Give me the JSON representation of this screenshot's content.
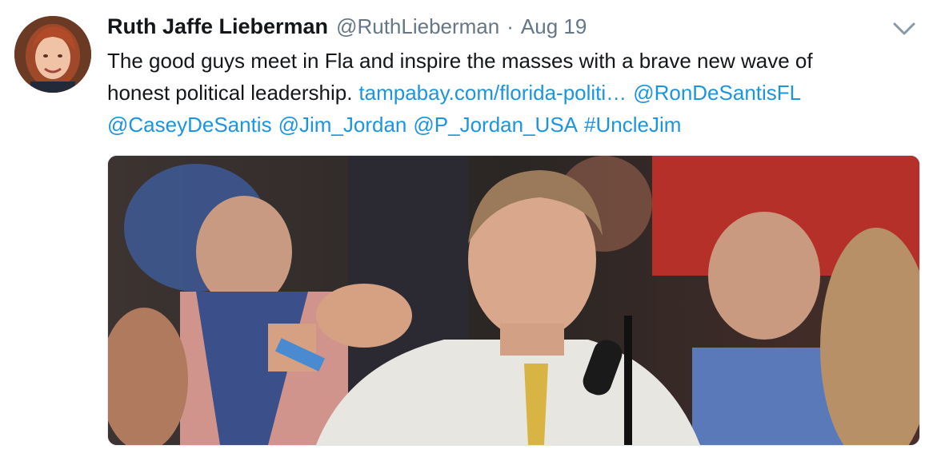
{
  "tweet": {
    "author_name": "Ruth Jaffe Lieberman",
    "author_handle": "@RuthLieberman",
    "separator": "·",
    "date": "Aug 19",
    "text_line1": "The good guys meet in Fla and inspire the masses with a brave new wave of",
    "text_line2_plain": "honest political leadership.",
    "link_url_text": "tampabay.com/florida-politi…",
    "mention_1": "@RonDeSantisFL",
    "mention_2": "@CaseyDeSantis",
    "mention_3": "@Jim_Jordan",
    "mention_4": "@P_Jordan_USA",
    "hashtag": "#UncleJim"
  },
  "icons": {
    "avatar": "profile-photo",
    "menu": "chevron-down-icon"
  },
  "colors": {
    "text": "#14171a",
    "secondary": "#657786",
    "link": "#1b95e0",
    "border": "#e1e8ed"
  }
}
